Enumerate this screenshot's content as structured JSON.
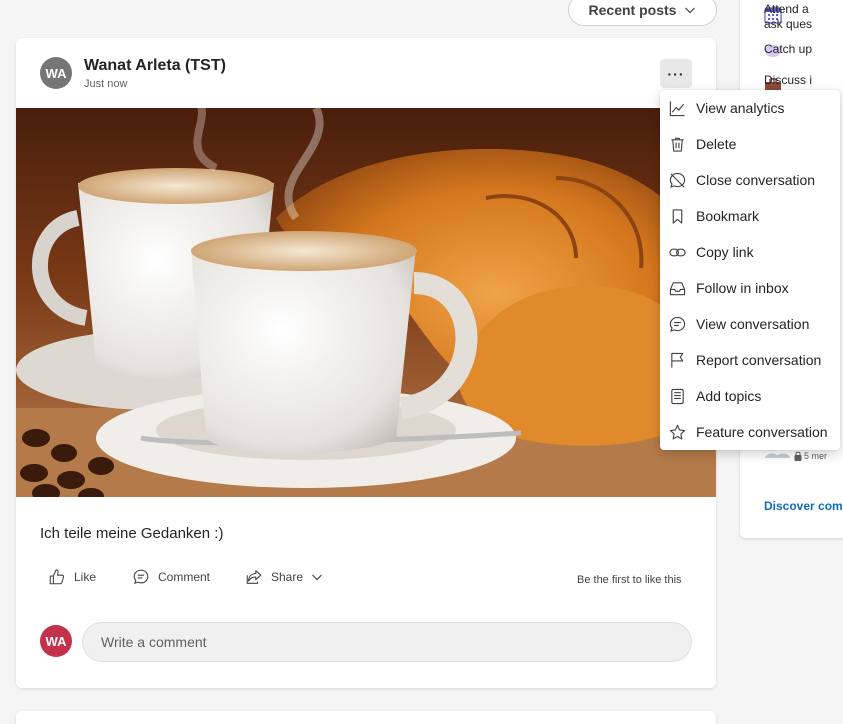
{
  "sort": {
    "label": "Recent posts"
  },
  "post": {
    "author_initials": "WA",
    "author_name": "Wanat Arleta (TST)",
    "time": "Just now",
    "more_label": "···",
    "text": "Ich teile meine Gedanken :)",
    "actions": {
      "like": "Like",
      "comment": "Comment",
      "share": "Share"
    },
    "like_status": "Be the first to like this"
  },
  "comment_box": {
    "avatar_initials": "WA",
    "placeholder": "Write a comment"
  },
  "menu": {
    "items": [
      {
        "label": "View analytics",
        "icon": "analytics-icon"
      },
      {
        "label": "Delete",
        "icon": "trash-icon"
      },
      {
        "label": "Close conversation",
        "icon": "close-conversation-icon"
      },
      {
        "label": "Bookmark",
        "icon": "bookmark-icon"
      },
      {
        "label": "Copy link",
        "icon": "link-icon"
      },
      {
        "label": "Follow in inbox",
        "icon": "inbox-icon"
      },
      {
        "label": "View conversation",
        "icon": "conversation-icon"
      },
      {
        "label": "Report conversation",
        "icon": "flag-icon"
      },
      {
        "label": "Add topics",
        "icon": "topics-icon"
      },
      {
        "label": "Feature conversation",
        "icon": "star-icon"
      }
    ]
  },
  "sidebar": {
    "items": [
      {
        "line1": "Attend a",
        "line2": "ask ques"
      },
      {
        "line1": "Catch up"
      },
      {
        "line1": "Discuss i"
      }
    ],
    "meta": "5 mer",
    "discover": "Discover comm"
  },
  "colors": {
    "accent": "#0f6cbd",
    "avatar_gray": "#757575",
    "avatar_red": "#c4314b"
  }
}
